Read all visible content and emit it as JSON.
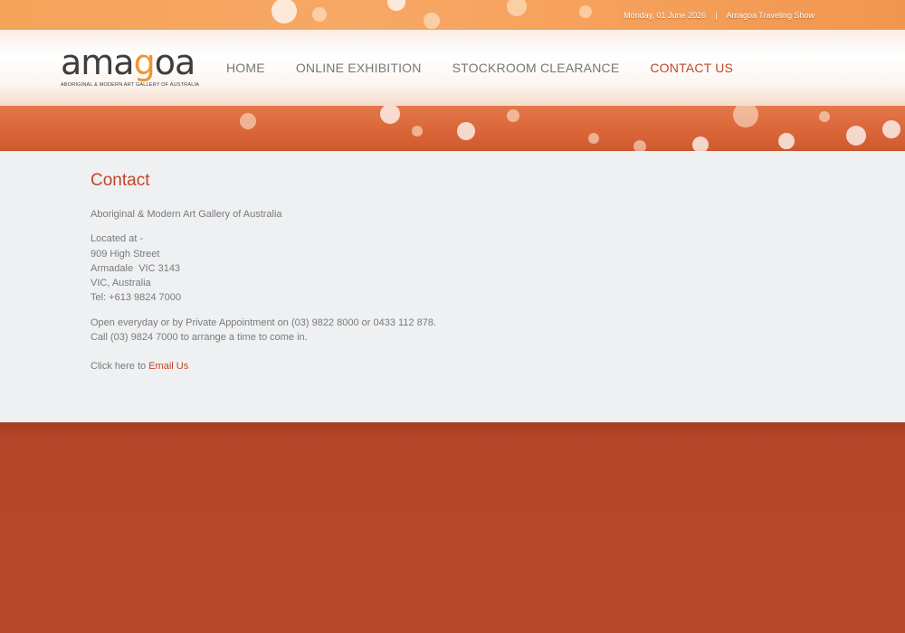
{
  "topbar": {
    "date": "Monday, 01 June 2026",
    "separator": "|",
    "link": "Amagoa Traveling Show"
  },
  "logo": {
    "word_before": "ama",
    "word_highlight": "g",
    "word_after": "oa",
    "tagline": "ABORIGINAL & MODERN ART GALLERY OF AUSTRALIA"
  },
  "nav": {
    "items": [
      {
        "label": "HOME"
      },
      {
        "label": "ONLINE EXHIBITION"
      },
      {
        "label": "STOCKROOM CLEARANCE"
      },
      {
        "label": "CONTACT US"
      }
    ],
    "active": "CONTACT US"
  },
  "content": {
    "title": "Contact",
    "gallery_name": "Aboriginal & Modern Art Gallery of Australia",
    "address": {
      "intro": "Located at -",
      "street": "909 High Street",
      "suburb": "Armadale  VIC 3143",
      "state_country": "VIC, Australia",
      "phone": "Tel: +613 9824 7000"
    },
    "hours_line1": "Open everyday or by Private Appointment on (03) 9822 8000 or 0433 112 878.",
    "hours_line2": "Call (03) 9824 7000 to arrange a time to come in.",
    "email_prefix": "Click here to",
    "email_link": "Email Us"
  },
  "colors": {
    "accent": "#c2452a",
    "logo_accent": "#f29232",
    "text": "#7a7a7a",
    "background": "#b8482a"
  }
}
